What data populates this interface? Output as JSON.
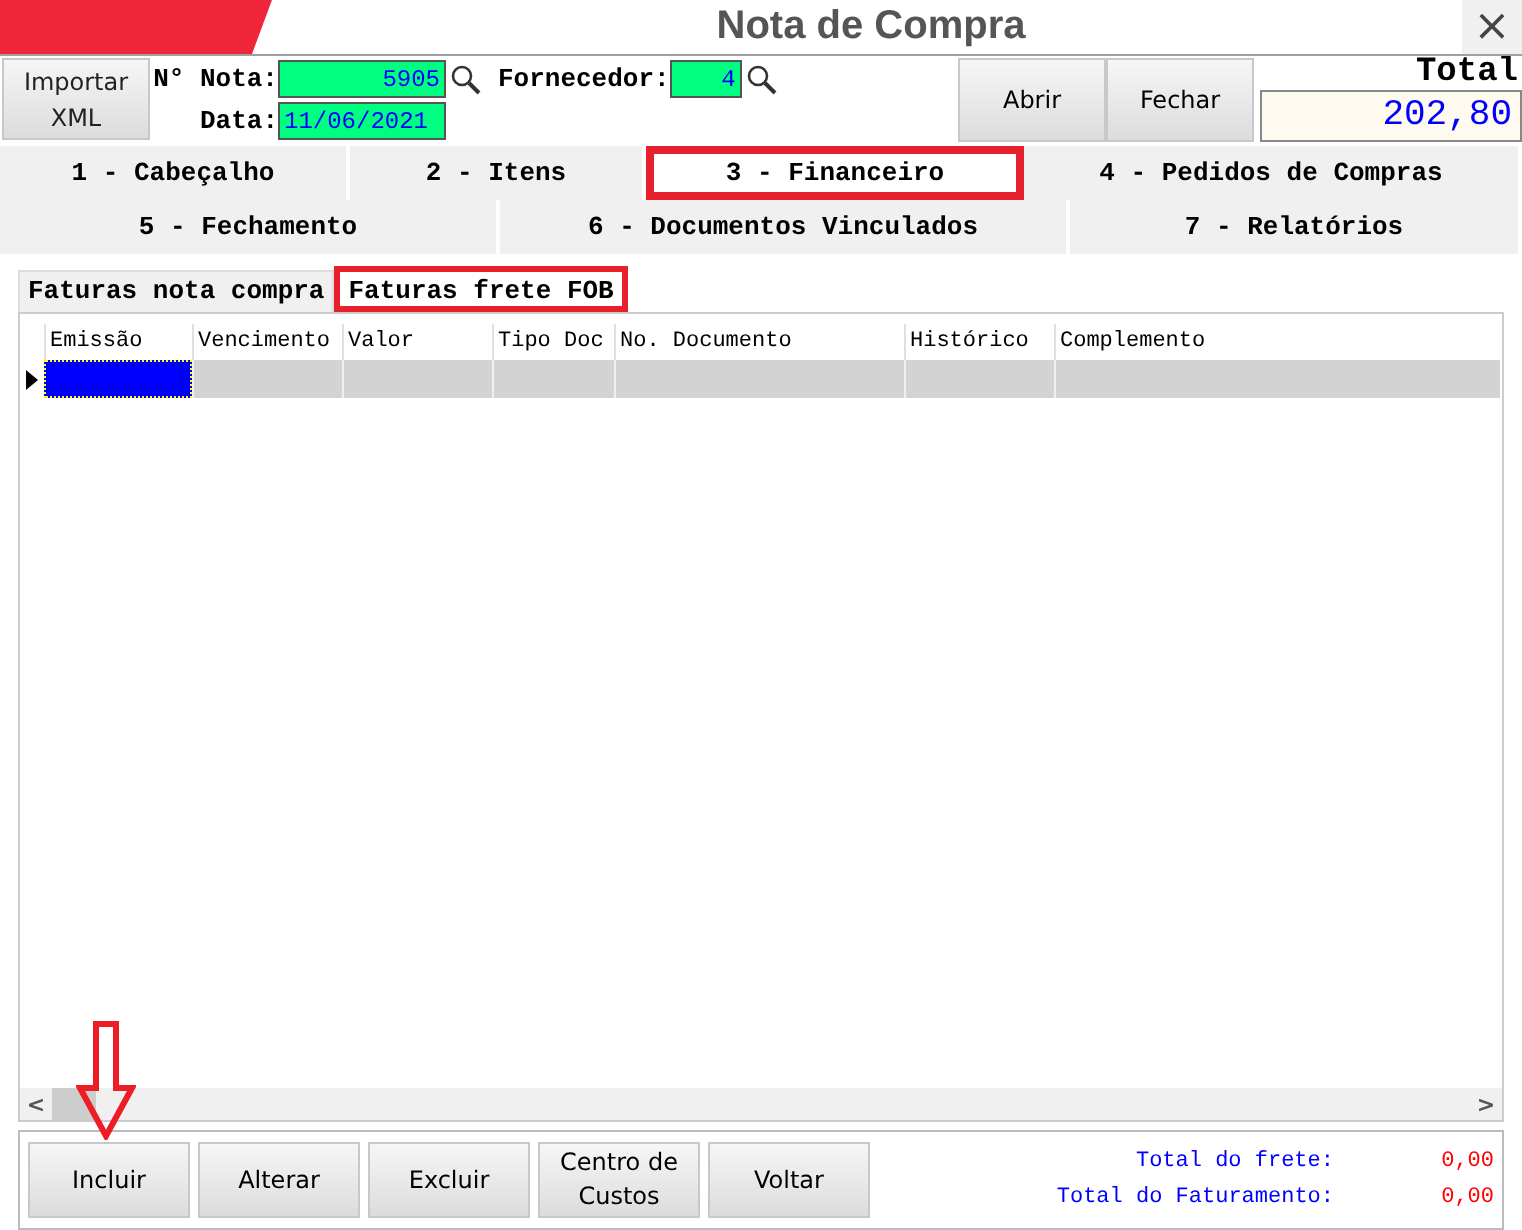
{
  "window": {
    "title": "Nota de Compra",
    "close": "×"
  },
  "header": {
    "import_button": "Importar XML",
    "nota_label": "N° Nota:",
    "nota_value": "5905",
    "data_label": "Data:",
    "data_value": "11/06/2021",
    "fornecedor_label": "Fornecedor:",
    "fornecedor_value": "4",
    "buttons": [
      "Abrir",
      "Fechar"
    ],
    "total_label": "Total",
    "total_value": "202,80"
  },
  "tabs": [
    [
      {
        "label": "1 - Cabeçalho",
        "selected": false
      },
      {
        "label": "2 - Itens",
        "selected": false
      },
      {
        "label": "3 - Financeiro",
        "selected": true
      },
      {
        "label": "4 - Pedidos de Compras",
        "selected": false
      }
    ],
    [
      {
        "label": "5 - Fechamento",
        "selected": false
      },
      {
        "label": "6 - Documentos Vinculados",
        "selected": false
      },
      {
        "label": "7 - Relatórios",
        "selected": false
      }
    ]
  ],
  "subtabs": [
    {
      "label": "Faturas nota compra",
      "selected": false
    },
    {
      "label": "Faturas frete FOB",
      "selected": true
    }
  ],
  "table": {
    "columns": [
      "Emissão",
      "Vencimento",
      "Valor",
      "Tipo Doc",
      "No. Documento",
      "Histórico",
      "Complemento"
    ],
    "rows": [
      {
        "selected": true
      }
    ]
  },
  "scrollbar": {
    "left": "<",
    "right": ">"
  },
  "buttons": [
    "Incluir",
    "Alterar",
    "Excluir",
    "Centro de Custos",
    "Voltar"
  ],
  "totals": [
    {
      "label": "Total do frete:",
      "value": "0,00"
    },
    {
      "label": "Total do Faturamento:",
      "value": "0,00"
    }
  ],
  "annotation_arrow": true
}
